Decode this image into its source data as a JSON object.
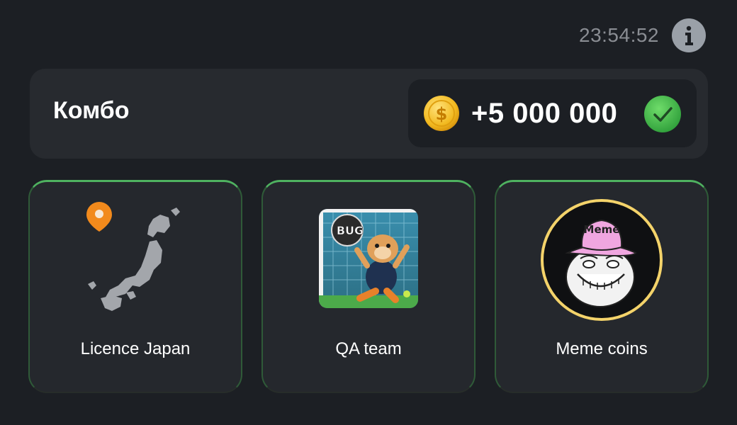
{
  "header": {
    "timer": "23:54:52",
    "info_icon": "info-icon"
  },
  "combo": {
    "title": "Комбо",
    "reward": "+5 000 000",
    "coin_icon": "coin-icon",
    "status_icon": "check-icon",
    "status_color": "#3fb84f"
  },
  "cards": [
    {
      "label": "Licence Japan",
      "image": "japan-map-image"
    },
    {
      "label": "QA team",
      "image": "qa-team-image",
      "badge": "BUG"
    },
    {
      "label": "Meme coins",
      "image": "meme-coins-image",
      "badge": "Meme"
    }
  ],
  "colors": {
    "background": "#1c1f24",
    "panel": "#272a2f",
    "card_border_active": "#4fb260",
    "coin_gold": "#f2b91f",
    "text_muted": "#8a8d93"
  }
}
